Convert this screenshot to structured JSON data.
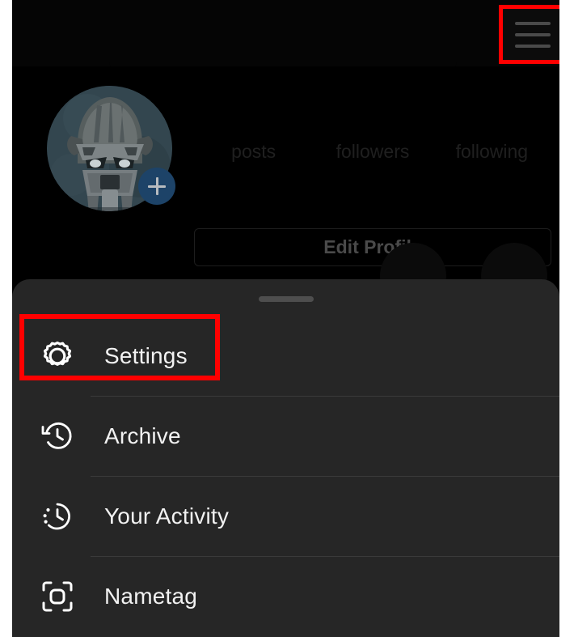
{
  "app": "instagram-profile",
  "colors": {
    "screen_background": "#000000",
    "sheet_background": "#262626",
    "highlight_box": "#ff0000",
    "add_badge_blue": "#1d4368",
    "menu_label": "#f2f2f2",
    "divider": "#3a3a3a"
  },
  "top_bar": {
    "menu_button_label": "hamburger-menu",
    "highlighted": true
  },
  "profile": {
    "avatar_alt": "masked-warrior-avatar",
    "add_badge_symbol": "+",
    "stats": [
      {
        "value": "",
        "label": "posts"
      },
      {
        "value": "",
        "label": "followers"
      },
      {
        "value": "",
        "label": "following"
      }
    ],
    "edit_profile_label": "Edit Profile"
  },
  "bottom_sheet": {
    "drag_handle": true,
    "menu_items": [
      {
        "icon": "gear-icon",
        "label": "Settings",
        "highlighted": true
      },
      {
        "icon": "archive-clock-icon",
        "label": "Archive",
        "highlighted": false
      },
      {
        "icon": "activity-clock-icon",
        "label": "Your Activity",
        "highlighted": false
      },
      {
        "icon": "nametag-scan-icon",
        "label": "Nametag",
        "highlighted": false
      }
    ]
  }
}
